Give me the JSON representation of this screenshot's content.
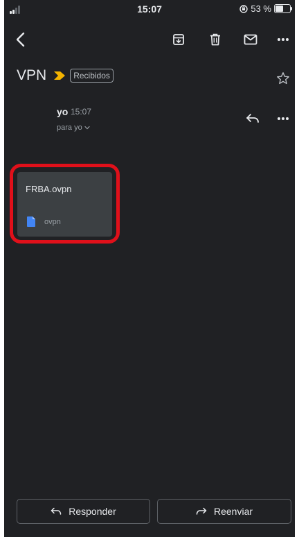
{
  "status_bar": {
    "time": "15:07",
    "battery_label": "53 %"
  },
  "toolbar": {
    "back_icon": "chevron-left-icon",
    "archive_icon": "archive-icon",
    "delete_icon": "trash-icon",
    "mark_unread_icon": "envelope-icon",
    "more_icon": "more-horizontal-icon"
  },
  "email": {
    "subject": "VPN",
    "label": "Recibidos",
    "sender": "yo",
    "time": "15:07",
    "recipient": "para yo"
  },
  "attachment": {
    "file_name": "FRBA.ovpn",
    "file_type": "ovpn"
  },
  "actions": {
    "respond_label": "Responder",
    "forward_label": "Reenviar"
  },
  "colors": {
    "background": "#202124",
    "importance_marker": "#f5b400",
    "highlight": "#e0101a",
    "file_icon": "#4285f4"
  }
}
